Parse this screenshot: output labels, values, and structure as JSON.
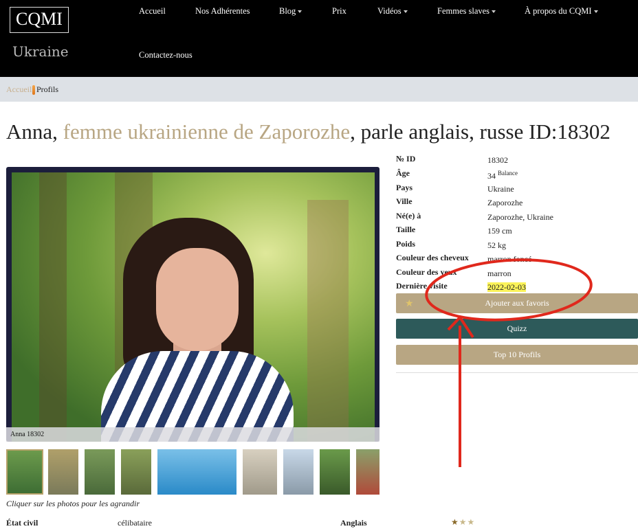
{
  "logo": {
    "main": "CQMI",
    "sub": "Ukraine"
  },
  "nav": {
    "accueil": "Accueil",
    "adherentes": "Nos Adhérentes",
    "blog": "Blog",
    "prix": "Prix",
    "videos": "Vidéos",
    "femmes": "Femmes slaves",
    "apropos": "À propos du CQMI",
    "contact": "Contactez-nous"
  },
  "breadcrumb": {
    "home": "Accueil",
    "current": "Profils"
  },
  "title": {
    "name": "Anna, ",
    "accent": "femme ukrainienne de Zaporozhe",
    "rest": ", parle anglais, russe ID:18302"
  },
  "photo": {
    "caption": "Anna 18302",
    "hint": "Cliquer sur les photos pour les agrandir"
  },
  "profile": {
    "rows": [
      {
        "label": "№ ID",
        "value": "18302"
      },
      {
        "label": "Âge",
        "value": "34",
        "extra": "Balance"
      },
      {
        "label": "Pays",
        "value": "Ukraine"
      },
      {
        "label": "Ville",
        "value": "Zaporozhe"
      },
      {
        "label": "Né(e) à",
        "value": "Zaporozhe, Ukraine"
      },
      {
        "label": "Taille",
        "value": "159 cm"
      },
      {
        "label": "Poids",
        "value": "52 kg"
      },
      {
        "label": "Couleur des cheveux",
        "value": "marron foncé"
      },
      {
        "label": "Couleur des yeux",
        "value": "marron"
      },
      {
        "label": "Dernière visite",
        "value": "2022-02-03"
      }
    ]
  },
  "buttons": {
    "favoris": "Ajouter aux favoris",
    "quizz": "Quizz",
    "top10": "Top 10 Profils"
  },
  "bottom": {
    "etat_label": "État civil",
    "etat_value": "célibataire",
    "anglais_label": "Anglais"
  },
  "colors": {
    "accent": "#b8a683",
    "dark_button": "#2d5a5a",
    "annotation": "#e0281c"
  },
  "icons": {
    "favorite": "star-icon",
    "caret": "caret-down-icon"
  },
  "anglais_rating": 1
}
